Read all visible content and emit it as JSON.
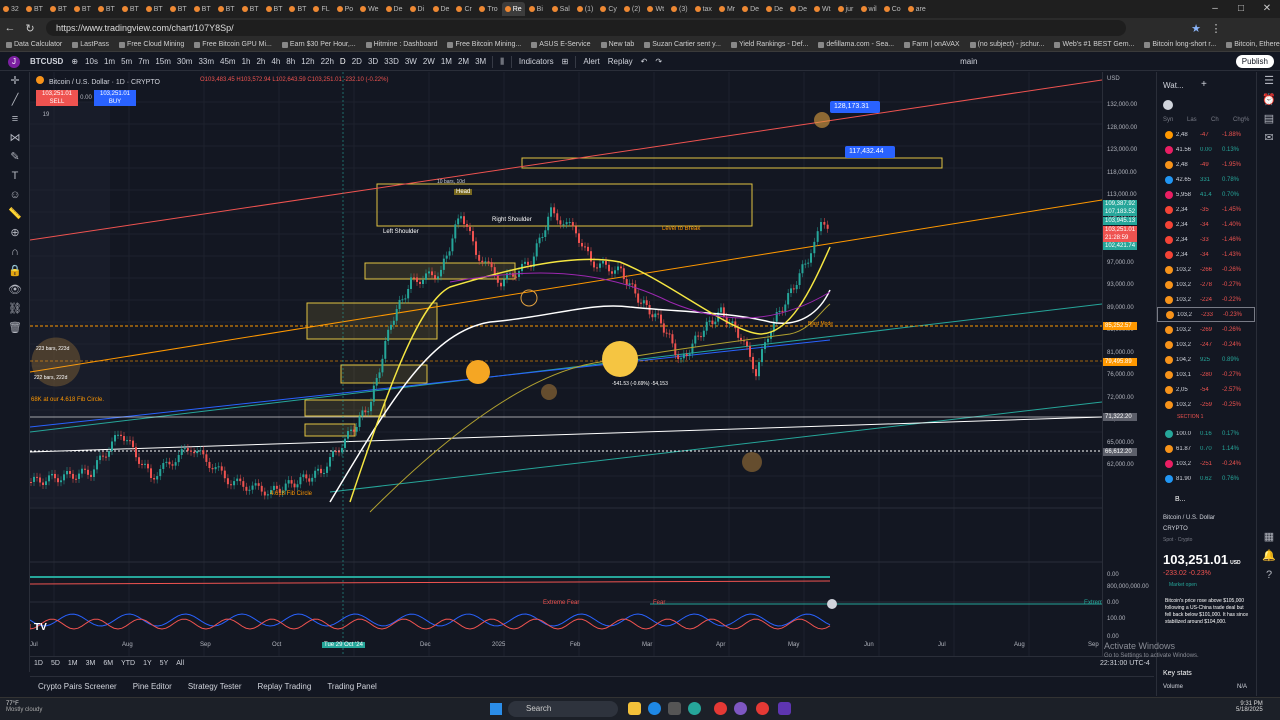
{
  "browser": {
    "tabs": [
      "32",
      "BT",
      "BT",
      "BT",
      "BT",
      "BT",
      "BT",
      "BT",
      "BT",
      "BT",
      "BT",
      "BT",
      "BT",
      "FL",
      "Po",
      "We",
      "De",
      "Di",
      "De",
      "Cr",
      "Tro",
      "Re",
      "Bi",
      "Sal",
      "(1)",
      "Cy",
      "(2)",
      "Wt",
      "(3)",
      "tax",
      "Mr",
      "De",
      "De",
      "De",
      "Wt",
      "jur",
      "wil",
      "Co",
      "are"
    ],
    "url": "https://www.tradingview.com/chart/107Y8Sp/",
    "bookmarks": [
      "Data Calculator",
      "LastPass",
      "Free Cloud Mining",
      "Free Bitcoin GPU Mi...",
      "Earn $30 Per Hour,...",
      "Hitmine : Dashboard",
      "Free Bitcoin Mining...",
      "ASUS E-Service",
      "New tab",
      "Suzan Cartier sent y...",
      "Yield Rankings - Def...",
      "defillama.com - Sea...",
      "Farm | onAVAX",
      "(no subject) - jschur...",
      "Web's #1 BEST Gem...",
      "Bitcoin long-short r...",
      "Bitcoin, Ethereum, a...",
      "Other favorites"
    ]
  },
  "toolbar": {
    "symbol": "BTCUSD",
    "intervals": [
      "10s",
      "1m",
      "5m",
      "7m",
      "15m",
      "30m",
      "33m",
      "45m",
      "1h",
      "2h",
      "4h",
      "8h",
      "12h",
      "22h",
      "D",
      "2D",
      "3D",
      "33D",
      "3W",
      "2W",
      "1M",
      "2M",
      "3M"
    ],
    "indicators": "Indicators",
    "alert": "Alert",
    "replay": "Replay",
    "layout": "main",
    "publish": "Publish"
  },
  "legend": {
    "title": "Bitcoin / U.S. Dollar · 1D · CRYPTO",
    "ohlc": "O103,483.45 H103,572.94 L102,643.59 C103,251.01 -232.10 (-0.22%)",
    "sell_price": "103,251.01",
    "sell_label": "SELL",
    "spread": "0.00",
    "buy_price": "103,251.01",
    "buy_label": "BUY",
    "indicator_count": "19"
  },
  "annotations": {
    "target_high": "128,173.31",
    "target_mid": "117,432.44",
    "head_bars": "10 bars, 10d",
    "head": "Head",
    "left_shoulder": "Left Shoulder",
    "right_shoulder": "Right Shoulder",
    "level_to_break": "Level to Break",
    "measure": "-541.53 (-0.69%) -54,153",
    "bars_223": "223 bars, 223d",
    "bars_222": "222 bars, 222d",
    "fib": "68K at our 4.618 Fib Circle.",
    "fib_circle": "4.618 Fib Circle",
    "blast": "Blast Mode",
    "extreme_fear": "Extreme Fear",
    "fear": "Fear",
    "extreme_greed": "Extrem"
  },
  "price_axis": {
    "currency": "USD",
    "labels": [
      "132,000.00",
      "128,000.00",
      "123,000.00",
      "118,000.00",
      "113,000.00",
      "105,000.00",
      "101,000.00",
      "97,000.00",
      "93,000.00",
      "89,000.00",
      "85,000.00",
      "81,000.00",
      "76,000.00",
      "72,000.00",
      "68,000.00",
      "65,000.00",
      "62,000.00"
    ],
    "tag_green_1": "109,387.92",
    "tag_green_2": "107,183.52",
    "tag_green_3": "103,945.13",
    "tag_red": "103,251.01",
    "tag_time": "21:28:59",
    "tag_green_4": "102,421.74",
    "tag_orange_1": "85,252.57",
    "tag_orange_2": "79,495.89",
    "tag_white_1": "71,322.20",
    "tag_white_2": "66,612.20",
    "osc_labels": [
      "0.00",
      "800,000,000.00",
      "0.00",
      "100.00",
      "0.00"
    ]
  },
  "time_axis": {
    "labels": [
      "Jul",
      "Aug",
      "Sep",
      "Oct",
      "Tue 29 Oct '24",
      "Dec",
      "2025",
      "Feb",
      "Mar",
      "Apr",
      "May",
      "Jun",
      "Jul",
      "Aug",
      "Sep"
    ],
    "clock": "22:31:00 UTC-4"
  },
  "range_bar": [
    "1D",
    "5D",
    "1M",
    "3M",
    "6M",
    "YTD",
    "1Y",
    "5Y",
    "All"
  ],
  "bottom_tabs": [
    "Crypto Pairs Screener",
    "Pine Editor",
    "Strategy Tester",
    "Replay Trading",
    "Trading Panel"
  ],
  "watchlist": {
    "title": "Wat...",
    "cols": [
      "Syn",
      "Las",
      "Ch",
      "Chg%"
    ],
    "rows": [
      {
        "s": "2,48",
        "c": "-47",
        "p": "-1.88%",
        "col": "#ef5350",
        "ic": "#ff9800"
      },
      {
        "s": "41.56",
        "c": "0.00",
        "p": "0.13%",
        "col": "#26a69a",
        "ic": "#e91e63"
      },
      {
        "s": "2,48",
        "c": "-49",
        "p": "-1.95%",
        "col": "#ef5350",
        "ic": "#f7931a"
      },
      {
        "s": "42.65",
        "c": "331",
        "p": "0.78%",
        "col": "#26a69a",
        "ic": "#2196f3"
      },
      {
        "s": "5,958",
        "c": "41.4",
        "p": "0.70%",
        "col": "#26a69a",
        "ic": "#e91e63"
      },
      {
        "s": "2,34",
        "c": "-35",
        "p": "-1.45%",
        "col": "#ef5350",
        "ic": "#f44336"
      },
      {
        "s": "2,34",
        "c": "-34",
        "p": "-1.40%",
        "col": "#ef5350",
        "ic": "#f44336"
      },
      {
        "s": "2,34",
        "c": "-33",
        "p": "-1.46%",
        "col": "#ef5350",
        "ic": "#f44336"
      },
      {
        "s": "2,34",
        "c": "-34",
        "p": "-1.43%",
        "col": "#ef5350",
        "ic": "#f44336"
      },
      {
        "s": "103,2",
        "c": "-266",
        "p": "-0.26%",
        "col": "#ef5350",
        "ic": "#f7931a"
      },
      {
        "s": "103,2",
        "c": "-278",
        "p": "-0.27%",
        "col": "#ef5350",
        "ic": "#f7931a"
      },
      {
        "s": "103,2",
        "c": "-224",
        "p": "-0.22%",
        "col": "#ef5350",
        "ic": "#f7931a"
      },
      {
        "s": "103,2",
        "c": "-233",
        "p": "-0.23%",
        "col": "#ef5350",
        "ic": "#f7931a"
      },
      {
        "s": "103,2",
        "c": "-269",
        "p": "-0.26%",
        "col": "#ef5350",
        "ic": "#f7931a"
      },
      {
        "s": "103,2",
        "c": "-247",
        "p": "-0.24%",
        "col": "#ef5350",
        "ic": "#f7931a"
      },
      {
        "s": "104,2",
        "c": "925",
        "p": "0.89%",
        "col": "#26a69a",
        "ic": "#f7931a"
      },
      {
        "s": "103,1",
        "c": "-280",
        "p": "-0.27%",
        "col": "#ef5350",
        "ic": "#f7931a"
      },
      {
        "s": "2,05",
        "c": "-54",
        "p": "-2.57%",
        "col": "#ef5350",
        "ic": "#f7931a"
      },
      {
        "s": "103,2",
        "c": "-259",
        "p": "-0.25%",
        "col": "#ef5350",
        "ic": "#f7931a"
      }
    ],
    "section": "SECTION 1",
    "rows2": [
      {
        "s": "100.0",
        "c": "0.16",
        "p": "0.17%",
        "col": "#26a69a",
        "ic": "#26a69a"
      },
      {
        "s": "61.87",
        "c": "0.70",
        "p": "1.14%",
        "col": "#26a69a",
        "ic": "#f7931a"
      },
      {
        "s": "103,2",
        "c": "-251",
        "p": "-0.24%",
        "col": "#ef5350",
        "ic": "#e91e63"
      },
      {
        "s": "81.90",
        "c": "0.62",
        "p": "0.76%",
        "col": "#26a69a",
        "ic": "#2196f3"
      }
    ],
    "detail_sym": "B...",
    "detail_name": "Bitcoin / U.S. Dollar",
    "detail_ex": "CRYPTO",
    "detail_type": "Spot · Crypto",
    "price": "103,251.01",
    "price_unit": "USD",
    "change": "-233.02 -0.23%",
    "market": "Market open",
    "news": "Bitcoin's price rose above $105,000 following a US-China trade deal but fell back below $101,000. It has since stabilized around $104,000.",
    "key_stats": "Key stats",
    "volume": "Volume",
    "volume_val": "N/A"
  },
  "activate": {
    "line1": "Activate Windows",
    "line2": "Go to Settings to activate Windows."
  },
  "taskbar": {
    "weather_temp": "77°F",
    "weather_desc": "Mostly cloudy",
    "search": "Search",
    "time": "9:31 PM",
    "date": "5/18/2025"
  },
  "colors": {
    "up": "#26a69a",
    "down": "#ef5350",
    "accent": "#2962ff",
    "bg": "#131722"
  }
}
